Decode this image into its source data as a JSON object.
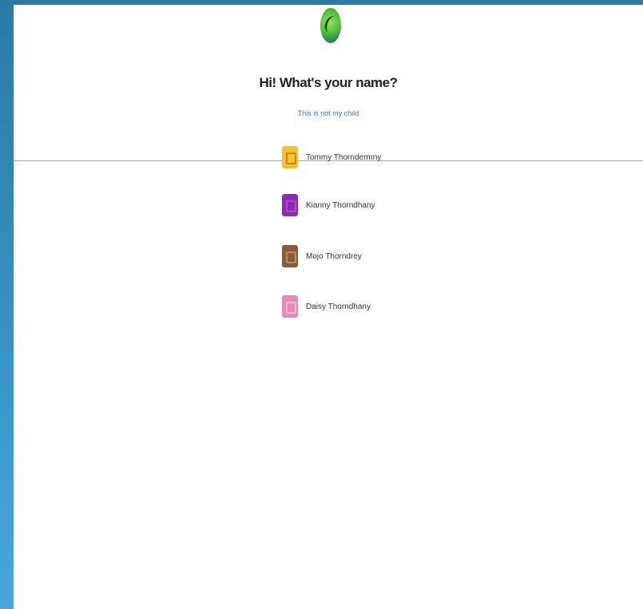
{
  "login": {
    "title": "Hi! What's your name?",
    "subtitle_link": "This is not my child",
    "profiles": [
      {
        "name": "Tommy Thorndermny",
        "icon": "yellow-avatar-icon",
        "color": "#f2c230",
        "accent": "#e07b1e"
      },
      {
        "name": "Kianny Thorndhany",
        "icon": "purple-avatar-icon",
        "color": "#8a2bb5",
        "accent": "#c23fc9"
      },
      {
        "name": "Mojo Thorndrey",
        "icon": "brown-avatar-icon",
        "color": "#8a5a3c",
        "accent": "#c08a66"
      },
      {
        "name": "Daisy Thorndhany",
        "icon": "pink-avatar-icon",
        "color": "#e88ab8",
        "accent": "#f4b6d6"
      }
    ]
  }
}
